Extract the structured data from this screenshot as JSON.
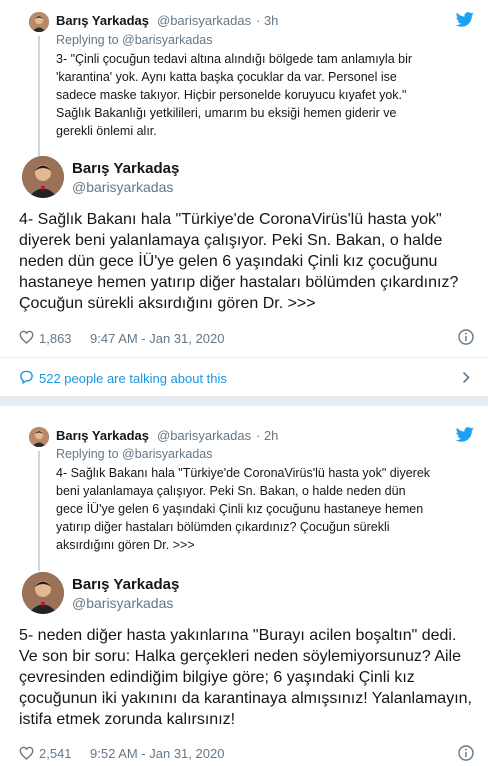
{
  "tweet1": {
    "quoted": {
      "name": "Barış Yarkadaş",
      "handle": "@barisyarkadas",
      "time": "· 3h",
      "replying_to": "Replying to @barisyarkadas",
      "text": "3- \"Çinli çocuğun tedavi altına alındığı bölgede tam anlamıyla bir\n'karantina' yok. Aynı katta başka çocuklar da var. Personel ise\nsadece maske takıyor. Hiçbir personelde koruyucu kıyafet yok.\"\nSağlık Bakanlığı yetkilileri, umarım bu eksiği hemen giderir ve\ngerekli önlemi alır."
    },
    "name": "Barış Yarkadaş",
    "handle": "@barisyarkadas",
    "text": "4- Sağlık Bakanı hala \"Türkiye'de CoronaVirüs'lü hasta yok\"\ndiyerek beni yalanlamaya çalışıyor. Peki Sn. Bakan, o halde\nneden dün gece İÜ'ye gelen 6 yaşındaki Çinli kız çocuğunu\nhastaneye hemen yatırıp diğer hastaları bölümden çıkardınız?\nÇocuğun sürekli aksırdığını gören Dr. >>>",
    "likes": "1,863",
    "timestamp": "9:47 AM - Jan 31, 2020",
    "talking": "522 people are talking about this"
  },
  "tweet2": {
    "quoted": {
      "name": "Barış Yarkadaş",
      "handle": "@barisyarkadas",
      "time": "· 2h",
      "replying_to": "Replying to @barisyarkadas",
      "text": "4- Sağlık Bakanı hala \"Türkiye'de CoronaVirüs'lü hasta yok\" diyerek\nbeni yalanlamaya çalışıyor. Peki Sn. Bakan, o halde neden dün\ngece İÜ'ye gelen 6 yaşındaki Çinli kız çocuğunu hastaneye hemen\nyatırıp diğer hastaları bölümden çıkardınız? Çocuğun sürekli\naksırdığını gören Dr. >>>"
    },
    "name": "Barış Yarkadaş",
    "handle": "@barisyarkadas",
    "text": "5- neden diğer hasta yakınlarına \"Burayı acilen boşaltın\" dedi.\nVe son bir soru: Halka gerçekleri neden söylemiyorsunuz? Aile\nçevresinden edindiğim bilgiye göre; 6 yaşındaki Çinli kız\nçocuğunun iki yakınını da karantinaya almışsınız! Yalanlamayın,\nistifa etmek zorunda kalırsınız!",
    "likes": "2,541",
    "timestamp": "9:52 AM - Jan 31, 2020"
  },
  "colors": {
    "twitter_blue": "#1da1f2",
    "link": "#1b95e0",
    "muted": "#657786"
  },
  "icons": [
    "twitter-bird-icon",
    "heart-icon",
    "info-icon",
    "chevron-right-icon"
  ]
}
